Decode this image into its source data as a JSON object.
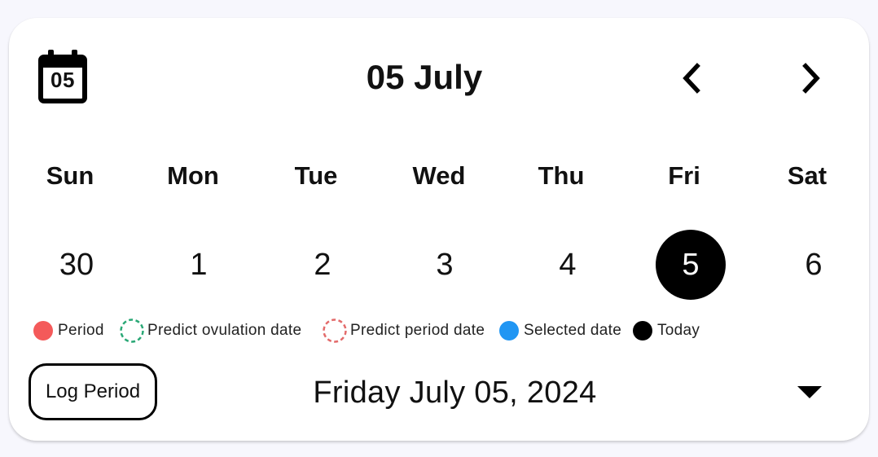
{
  "header": {
    "calendar_icon_day": "05",
    "month_title": "05 July"
  },
  "weekdays": [
    "Sun",
    "Mon",
    "Tue",
    "Wed",
    "Thu",
    "Fri",
    "Sat"
  ],
  "days": [
    "30",
    "1",
    "2",
    "3",
    "4",
    "5",
    "6"
  ],
  "today_index": 5,
  "legend": {
    "period": "Period",
    "predict_ovulation": "Predict ovulation date",
    "predict_period": "Predict period date",
    "selected": "Selected date",
    "today": "Today"
  },
  "colors": {
    "period": "#f45a5a",
    "ovulation": "#2aa876",
    "predict_period": "#e36b6b",
    "selected": "#2196f3",
    "today": "#000000"
  },
  "footer": {
    "log_button": "Log Period",
    "selected_full_date": "Friday July 05, 2024"
  }
}
